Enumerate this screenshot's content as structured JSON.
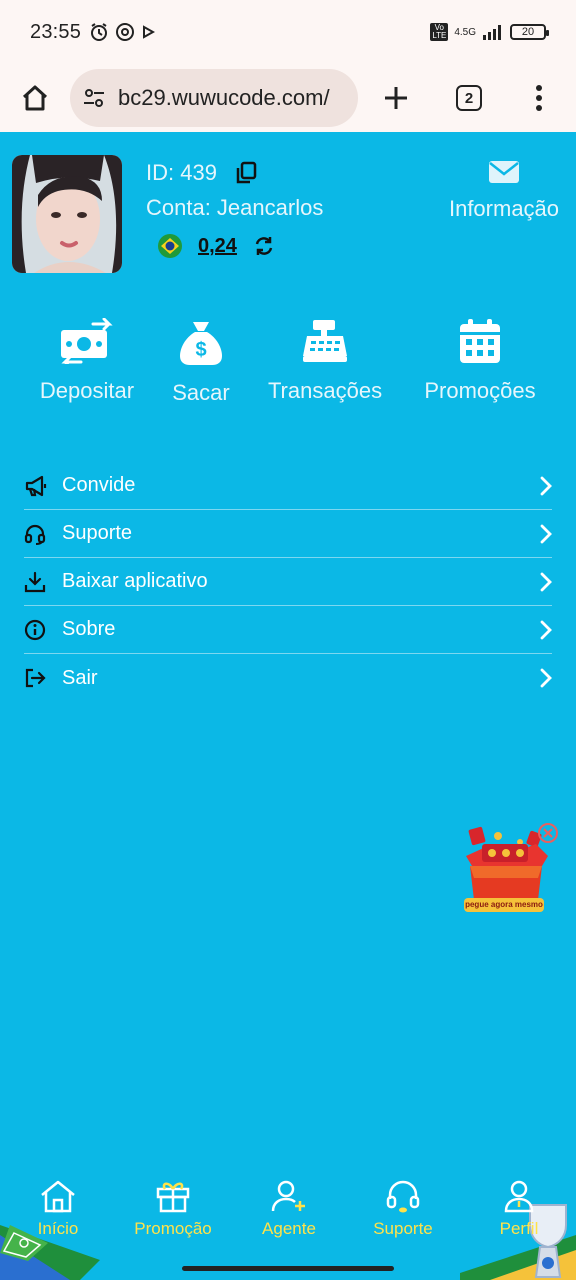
{
  "status": {
    "time": "23:55",
    "network": "4.5G",
    "battery": "20",
    "volte": "Vo LTE"
  },
  "browser": {
    "url": "bc29.wuwucode.com/",
    "tab_count": "2"
  },
  "profile": {
    "id_text": "ID: 439",
    "account_text": "Conta: Jeancarlos",
    "balance": "0,24",
    "info_label": "Informação"
  },
  "actions": [
    {
      "label": "Depositar",
      "icon": "deposit-icon"
    },
    {
      "label": "Sacar",
      "icon": "money-bag-icon"
    },
    {
      "label": "Transações",
      "icon": "cash-register-icon"
    },
    {
      "label": "Promoções",
      "icon": "calendar-icon"
    }
  ],
  "menu": [
    {
      "label": "Convide",
      "icon": "megaphone-icon"
    },
    {
      "label": "Suporte",
      "icon": "headset-icon"
    },
    {
      "label": "Baixar aplicativo",
      "icon": "download-icon"
    },
    {
      "label": "Sobre",
      "icon": "info-icon"
    },
    {
      "label": "Sair",
      "icon": "logout-icon"
    }
  ],
  "gift": {
    "caption": "pegue agora mesmo"
  },
  "bottom_nav": [
    {
      "label": "Início",
      "icon": "home-icon"
    },
    {
      "label": "Promoção",
      "icon": "gift-icon"
    },
    {
      "label": "Agente",
      "icon": "add-user-icon"
    },
    {
      "label": "Suporte",
      "icon": "headset-icon"
    },
    {
      "label": "Perfil",
      "icon": "user-icon"
    }
  ],
  "colors": {
    "background": "#0bb8e6",
    "nav_accent": "#ffe24a",
    "status_bar": "#fdf6f4"
  }
}
